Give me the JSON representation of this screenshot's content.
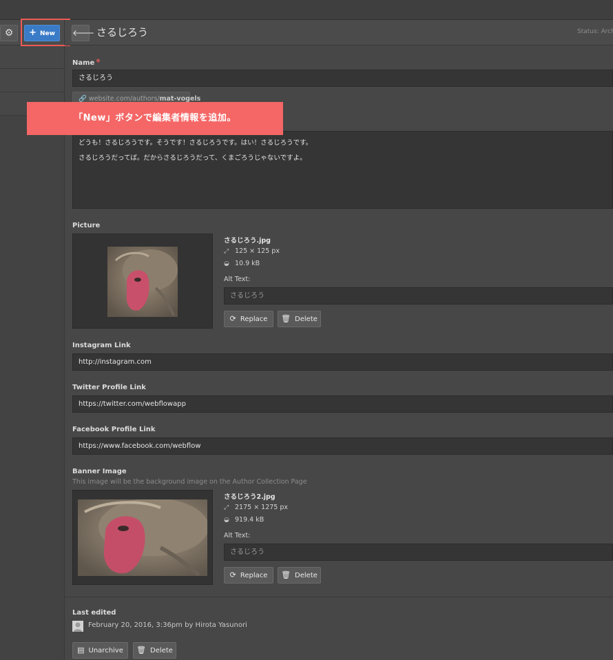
{
  "toolbar": {
    "new_label": "New",
    "settings_icon": "gear-icon"
  },
  "header": {
    "title": "さるじろう",
    "status": "Status: Arch",
    "back_icon": "arrow-left-icon"
  },
  "annotation": {
    "text": "「New」ボタンで編集者情報を追加。",
    "color": "#f46766"
  },
  "fields": {
    "name": {
      "label": "Name",
      "value": "さるじろう",
      "required_mark": "*"
    },
    "slug": {
      "prefix": "website.com/authors/",
      "value": "mat-vogels"
    },
    "bio": {
      "lines": [
        "どうも！さるじろうです。そうです！さるじろうです。はい！さるじろうです。",
        "さるじろうだってば。だからさるじろうだって、くまごろうじゃないですよ。"
      ]
    },
    "picture": {
      "label": "Picture",
      "file_name": "さるじろう.jpg",
      "dimensions": "125 × 125 px",
      "size": "10.9 kB",
      "alt_label": "Alt Text:",
      "alt_value": "さるじろう",
      "replace_label": "Replace",
      "delete_label": "Delete"
    },
    "instagram": {
      "label": "Instagram Link",
      "value": "http://instagram.com"
    },
    "twitter": {
      "label": "Twitter Profile Link",
      "value": "https://twitter.com/webflowapp"
    },
    "facebook": {
      "label": "Facebook Profile Link",
      "value": "https://www.facebook.com/webflow"
    },
    "banner_image": {
      "label": "Banner Image",
      "hint": "This image will be the background image on the Author Collection Page",
      "file_name": "さるじろう2.jpg",
      "dimensions": "2175 × 1275 px",
      "size": "919.4 kB",
      "alt_label": "Alt Text:",
      "alt_value": "さるじろう",
      "replace_label": "Replace",
      "delete_label": "Delete"
    }
  },
  "footer": {
    "last_edited_label": "Last edited",
    "last_edited_value": "February 20, 2016, 3:36pm by Hirota Yasunori",
    "unarchive_label": "Unarchive",
    "delete_label": "Delete"
  },
  "colors": {
    "accent": "#3a7bc7",
    "highlight": "#ee5b56",
    "background": "#474747"
  }
}
